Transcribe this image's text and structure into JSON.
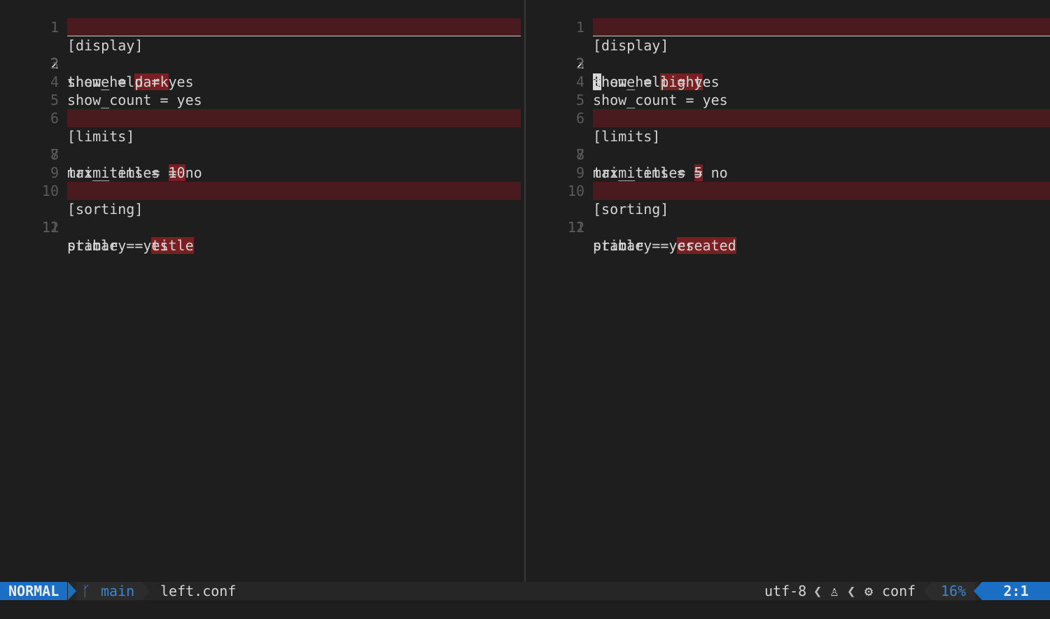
{
  "left": {
    "lines": [
      {
        "num": "1",
        "text": "[display]"
      },
      {
        "num": "2",
        "key": "theme = ",
        "val": "dark"
      },
      {
        "num": "3",
        "text": "show_help = yes"
      },
      {
        "num": "4",
        "text": "show_count = yes"
      },
      {
        "num": "5",
        "text": ""
      },
      {
        "num": "6",
        "text": "[limits]"
      },
      {
        "num": "7",
        "key": "max_items = ",
        "val": "10"
      },
      {
        "num": "8",
        "text": "trim_titles = no"
      },
      {
        "num": "9",
        "text": ""
      },
      {
        "num": "10",
        "text": "[sorting]"
      },
      {
        "num": "11",
        "key": "primary = ",
        "val": "title"
      },
      {
        "num": "12",
        "text": "stable = yes"
      }
    ]
  },
  "right": {
    "lines": [
      {
        "num": "1",
        "text": "[display]"
      },
      {
        "num": "2",
        "cursor_char": "t",
        "key": "heme = ",
        "val": "light"
      },
      {
        "num": "3",
        "text": "show_help = yes"
      },
      {
        "num": "4",
        "text": "show_count = yes"
      },
      {
        "num": "5",
        "text": ""
      },
      {
        "num": "6",
        "text": "[limits]"
      },
      {
        "num": "7",
        "key": "max_items = ",
        "val": "5"
      },
      {
        "num": "8",
        "text": "trim_titles = no"
      },
      {
        "num": "9",
        "text": ""
      },
      {
        "num": "10",
        "text": "[sorting]"
      },
      {
        "num": "11",
        "key": "primary = ",
        "val": "created"
      },
      {
        "num": "12",
        "text": "stable = yes"
      }
    ]
  },
  "statusline": {
    "mode": "NORMAL",
    "branch_icon": "ᚴ",
    "branch": "main",
    "filename": "left.conf",
    "encoding": "utf-8",
    "separator": "❮",
    "os_icon": "♙",
    "gear_icon": "⚙",
    "filetype": "conf",
    "percent": "16%",
    "position": "2:1"
  },
  "colors": {
    "background": "#1e1e1e",
    "diff_change_line": "#4a1b1e",
    "diff_change_text": "#7a1f22",
    "accent": "#1a6ec4"
  }
}
